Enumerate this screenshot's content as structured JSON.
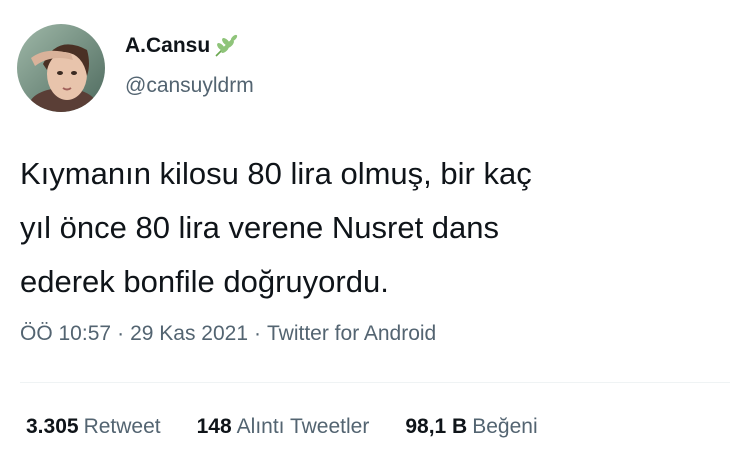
{
  "author": {
    "display_name": "A.Cansu",
    "handle": "@cansuyldrm",
    "name_emoji": "leaf-icon"
  },
  "tweet": {
    "lines": [
      "Kıymanın kilosu 80 lira olmuş, bir kaç",
      "yıl önce 80 lira verene Nusret dans",
      "ederek bonfile doğruyordu."
    ]
  },
  "meta": {
    "time": "ÖÖ 10:57",
    "separator": "·",
    "date": "29 Kas 2021",
    "source": "Twitter for Android"
  },
  "stats": [
    {
      "count": "3.305",
      "label": "Retweet"
    },
    {
      "count": "148",
      "label": "Alıntı Tweetler"
    },
    {
      "count": "98,1 B",
      "label": "Beğeni"
    }
  ],
  "colors": {
    "text": "#0f1419",
    "secondary": "#536471",
    "divider": "#eff3f4",
    "leaf": "#6aa84f"
  }
}
